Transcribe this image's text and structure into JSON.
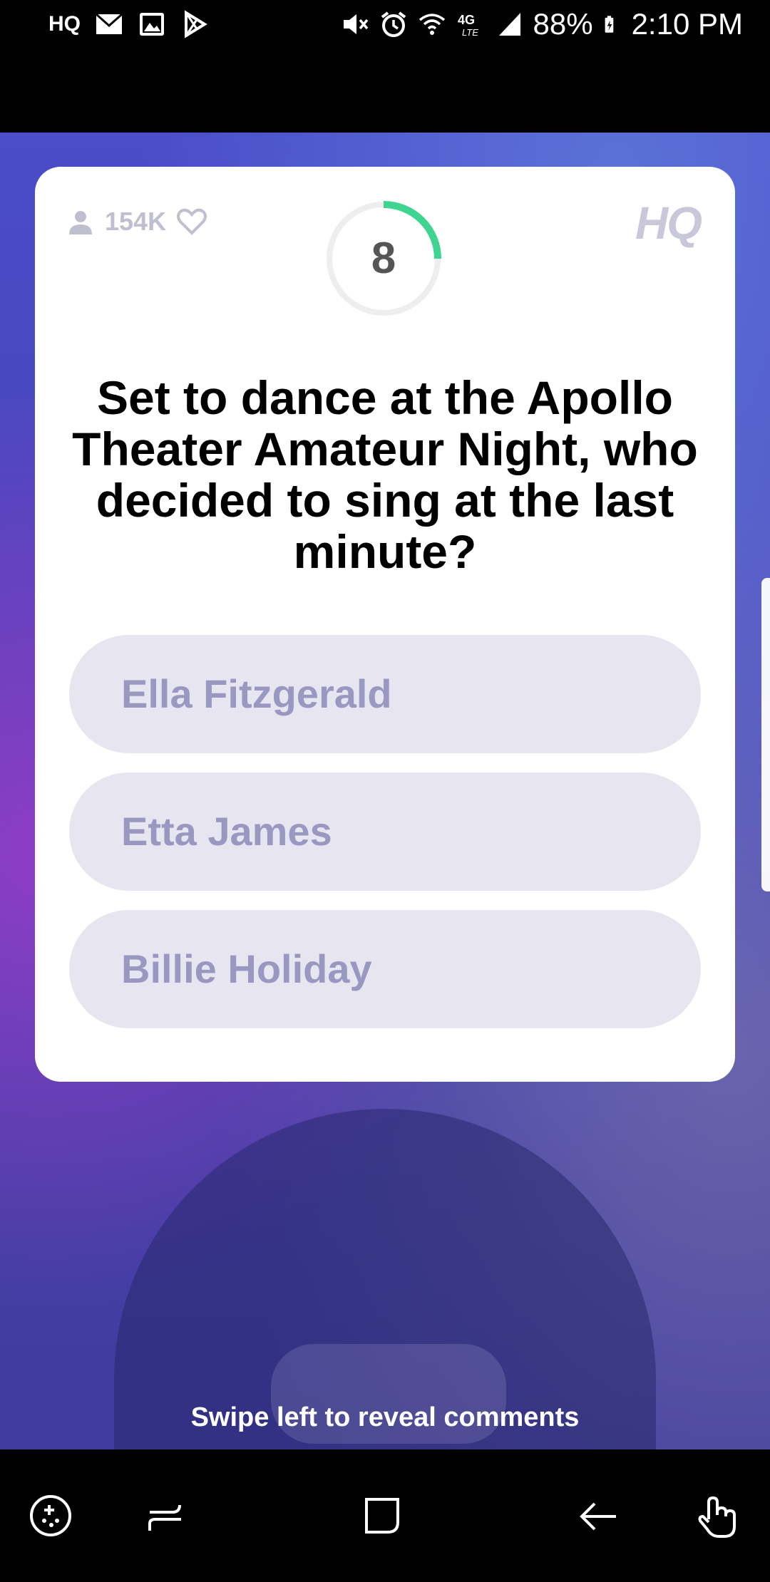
{
  "status_bar": {
    "left_icons": [
      "hq-app-icon",
      "mail-icon",
      "image-icon",
      "play-store-icon"
    ],
    "hq_label": "HQ",
    "right_icons": [
      "mute-icon",
      "alarm-icon",
      "wifi-icon",
      "4g-lte-icon",
      "signal-icon"
    ],
    "battery_percent": "88%",
    "time": "2:10 PM"
  },
  "card": {
    "viewer_count": "154K",
    "logo": "HQ",
    "timer": {
      "value": "8",
      "progress": 0.25,
      "track_color": "#eeeeee",
      "progress_color": "#3fd48f"
    },
    "question": "Set to dance at the Apollo Theater Amateur Night, who decided to sing at the last minute?",
    "answers": [
      {
        "label": "Ella Fitzgerald"
      },
      {
        "label": "Etta James"
      },
      {
        "label": "Billie Holiday"
      }
    ]
  },
  "hint": "Swipe left to reveal comments",
  "nav_bar": {
    "icons": [
      "game-tools-icon",
      "recents-icon",
      "home-icon",
      "back-icon",
      "touch-gesture-icon"
    ]
  },
  "colors": {
    "answer_bg": "#e7e6f0",
    "answer_text": "#9a98c0",
    "background_purple": "#4a4cc8"
  }
}
